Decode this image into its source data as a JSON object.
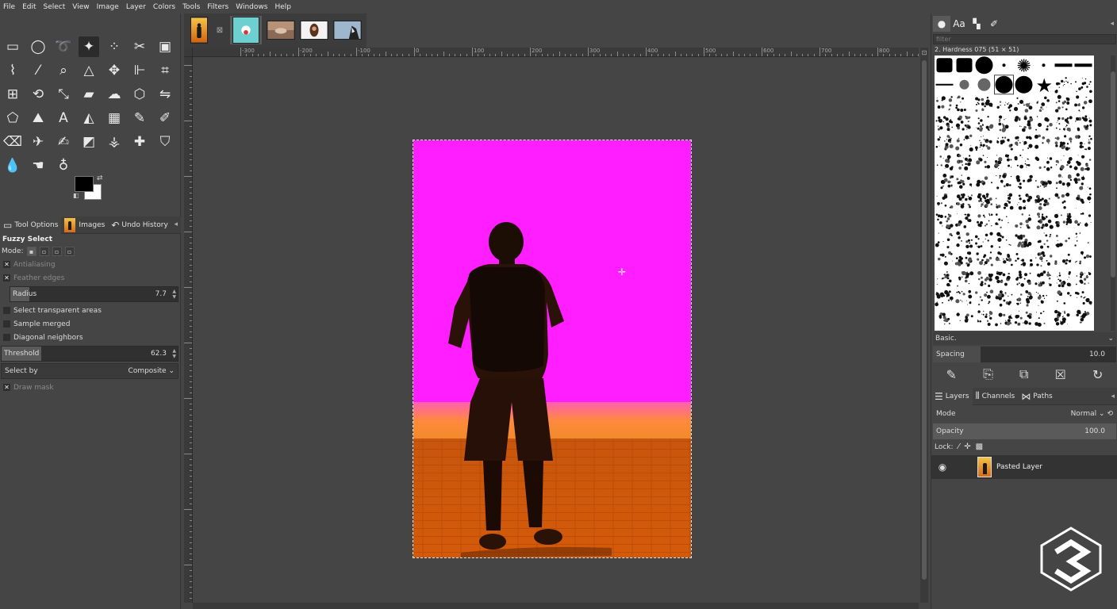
{
  "menu": [
    "File",
    "Edit",
    "Select",
    "View",
    "Image",
    "Layer",
    "Colors",
    "Tools",
    "Filters",
    "Windows",
    "Help"
  ],
  "left_tabs": {
    "tool_options": "Tool Options",
    "images": "Images",
    "undo_history": "Undo History"
  },
  "tool_options": {
    "title": "Fuzzy Select",
    "mode_label": "Mode:",
    "antialiasing": "Antialiasing",
    "feather_edges": "Feather edges",
    "radius_label": "Radius",
    "radius_value": "7.7",
    "select_transparent": "Select transparent areas",
    "sample_merged": "Sample merged",
    "diagonal_neighbors": "Diagonal neighbors",
    "threshold_label": "Threshold",
    "threshold_value": "62.3",
    "select_by_label": "Select by",
    "select_by_value": "Composite",
    "draw_mask": "Draw mask"
  },
  "rulers": {
    "horizontal": [
      "-300",
      "-200",
      "-100",
      "0",
      "100",
      "200",
      "300",
      "400",
      "500",
      "600",
      "700",
      "800"
    ]
  },
  "brushes": {
    "filter_placeholder": "filter",
    "selected_brush": "2. Hardness 075 (51 × 51)",
    "preset": "Basic.",
    "spacing_label": "Spacing",
    "spacing_value": "10.0"
  },
  "layers_tabs": {
    "layers": "Layers",
    "channels": "Channels",
    "paths": "Paths"
  },
  "layers": {
    "mode_label": "Mode",
    "mode_value": "Normal",
    "opacity_label": "Opacity",
    "opacity_value": "100.0",
    "lock_label": "Lock:",
    "items": [
      {
        "name": "Pasted Layer"
      }
    ]
  },
  "colors": {
    "foreground": "#000000",
    "background": "#ffffff",
    "sky": "#ff1eff",
    "ground": "#e0640e"
  }
}
